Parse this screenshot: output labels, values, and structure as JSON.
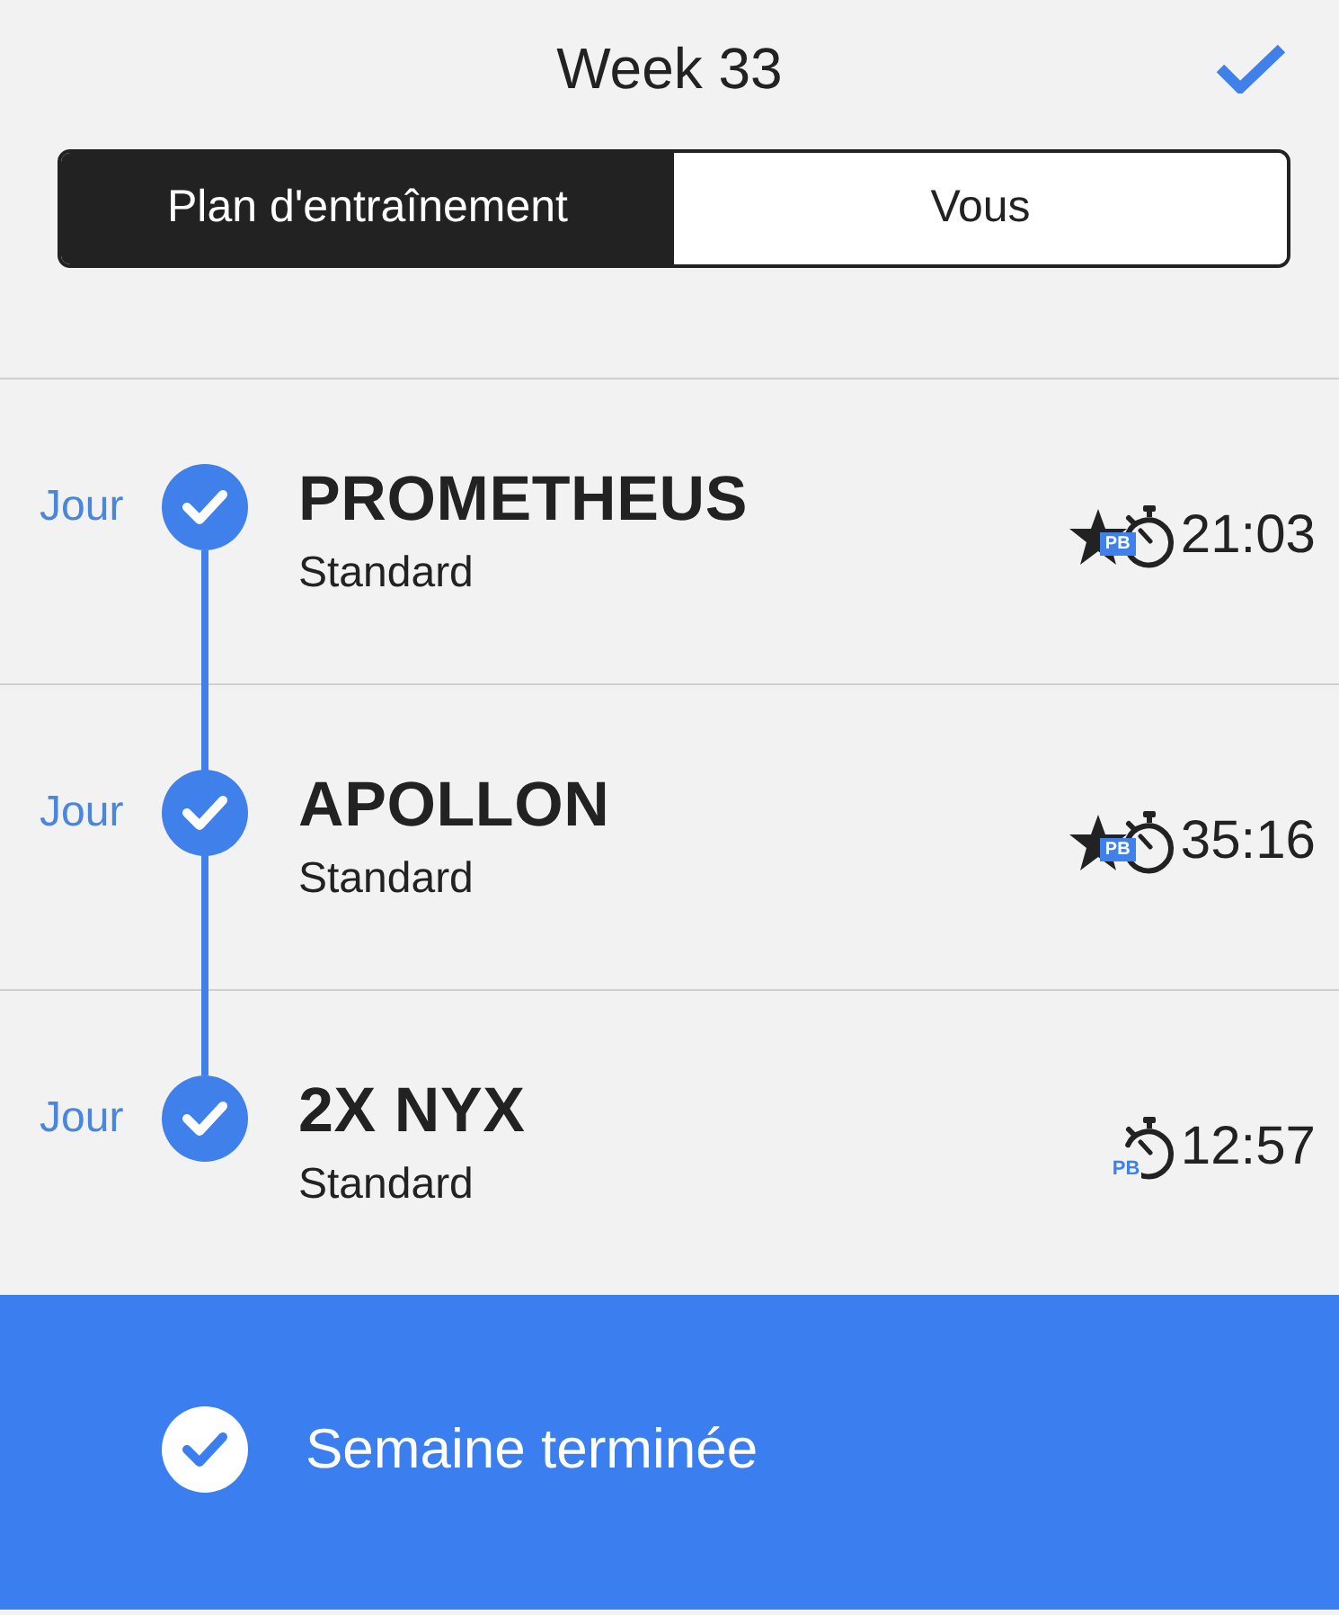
{
  "header": {
    "title": "Week 33"
  },
  "tabs": [
    {
      "label": "Plan d'entraînement",
      "selected": true
    },
    {
      "label": "Vous",
      "selected": false
    }
  ],
  "workouts": [
    {
      "day": "Jour",
      "completed": true,
      "name": "PROMETHEUS",
      "variant": "Standard",
      "starred": true,
      "badge": "PB",
      "time": "21:03"
    },
    {
      "day": "Jour",
      "completed": true,
      "name": "APOLLON",
      "variant": "Standard",
      "starred": true,
      "badge": "PB",
      "time": "35:16"
    },
    {
      "day": "Jour",
      "completed": true,
      "name": "2X NYX",
      "variant": "Standard",
      "starred": false,
      "badge": "PB",
      "time": "12:57"
    }
  ],
  "footer": {
    "completed": true,
    "label": "Semaine terminée"
  }
}
